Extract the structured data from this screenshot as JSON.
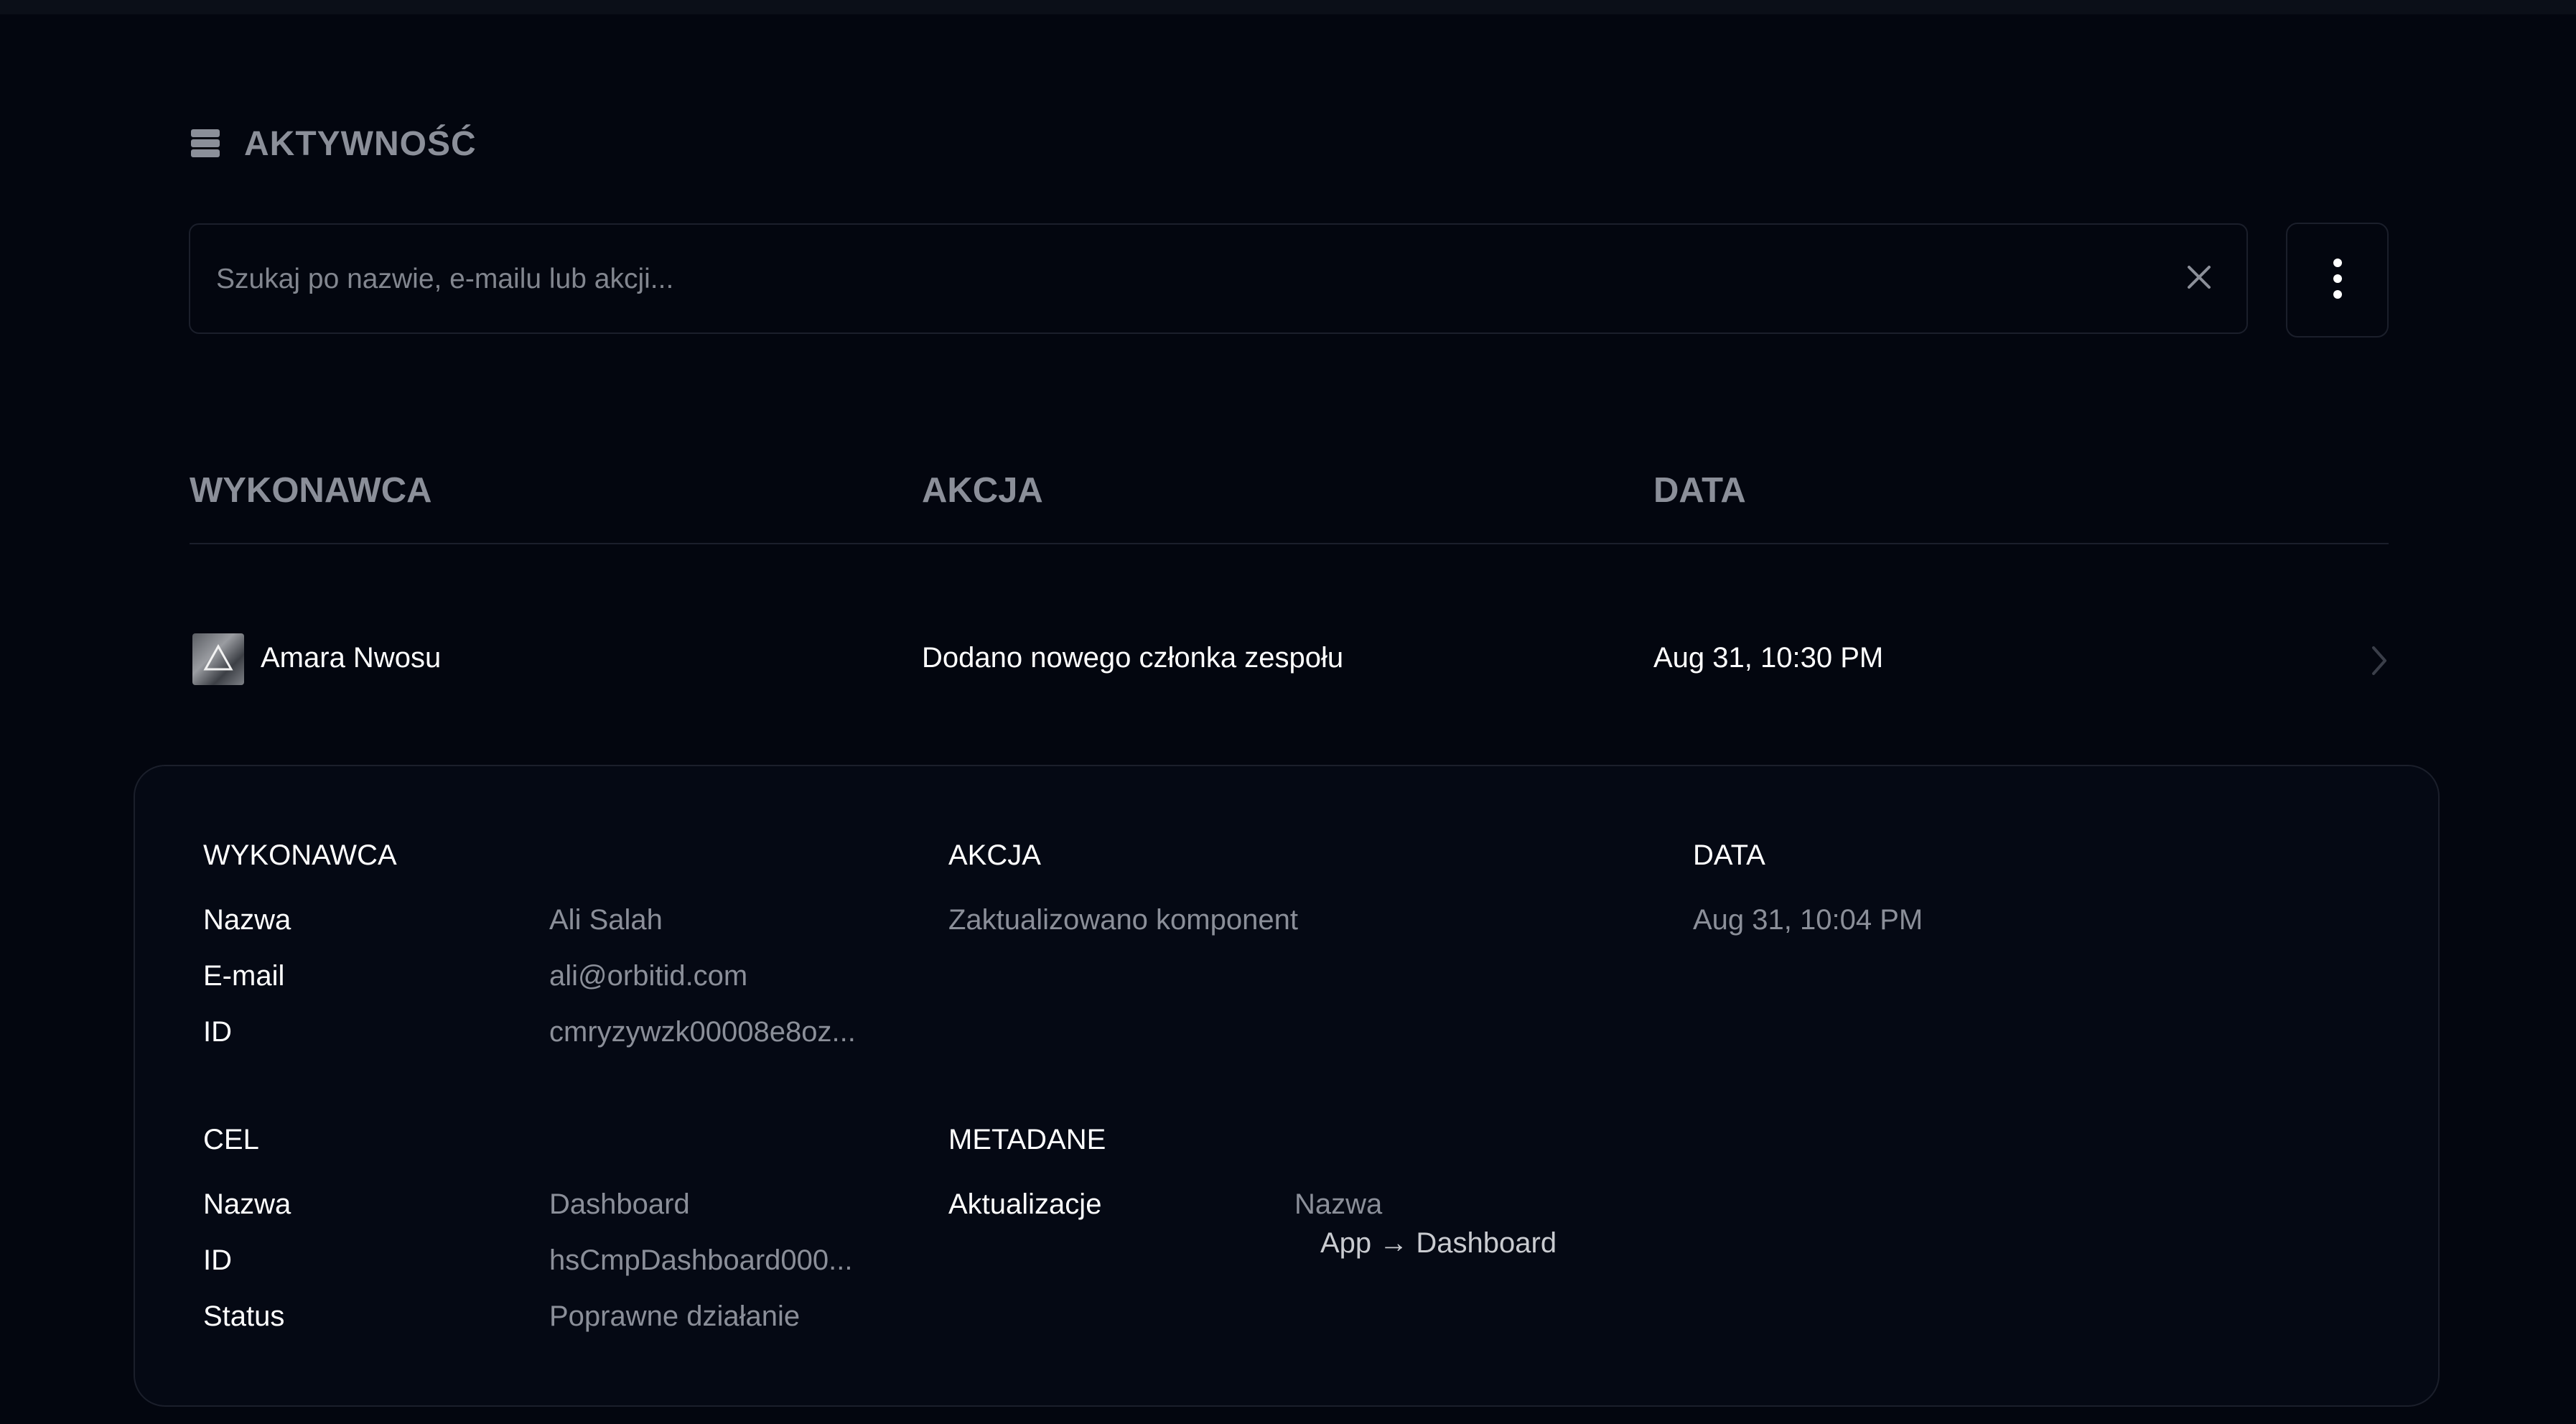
{
  "section": {
    "title": "AKTYWNOŚĆ",
    "icon": "database-icon"
  },
  "search": {
    "placeholder": "Szukaj po nazwie, e-mailu lub akcji...",
    "value": "",
    "clear_icon": "close-icon"
  },
  "menu": {
    "icon": "more-vertical-icon"
  },
  "table": {
    "headers": [
      "WYKONAWCA",
      "AKCJA",
      "DATA"
    ],
    "rows": [
      {
        "actor": "Amara Nwosu",
        "action": "Dodano nowego członka zespołu",
        "date": "Aug 31, 10:30 PM",
        "chevron_icon": "chevron-right-icon"
      }
    ]
  },
  "details": {
    "actor": {
      "heading": "WYKONAWCA",
      "name_label": "Nazwa",
      "name": "Ali Salah",
      "email_label": "E-mail",
      "email": "ali@orbitid.com",
      "id_label": "ID",
      "id": "cmryzywzk00008e8oz..."
    },
    "action": {
      "heading": "AKCJA",
      "value": "Zaktualizowano komponent"
    },
    "date": {
      "heading": "DATA",
      "value": "Aug 31, 10:04 PM"
    },
    "target": {
      "heading": "CEL",
      "name_label": "Nazwa",
      "name": "Dashboard",
      "id_label": "ID",
      "id": "hsCmpDashboard000...",
      "status_label": "Status",
      "status": "Poprawne działanie"
    },
    "metadata": {
      "heading": "METADANE",
      "updates_label": "Aktualizacje",
      "field_name": "Nazwa",
      "change": "App → Dashboard"
    }
  },
  "colors": {
    "background": "#03060f",
    "border": "#1b1f2b",
    "muted_text": "#8b8f99",
    "text": "#ffffff"
  }
}
